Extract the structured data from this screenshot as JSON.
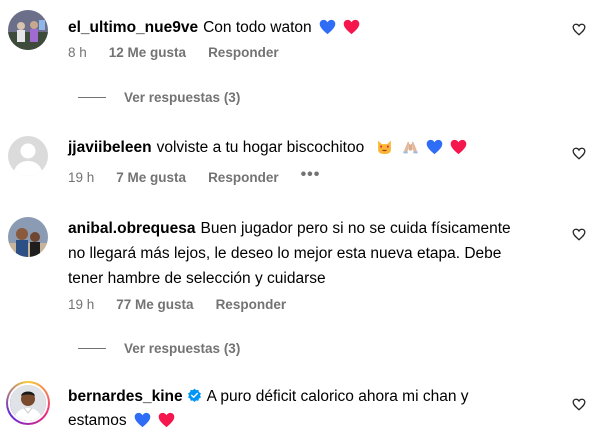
{
  "comments": [
    {
      "username": "el_ultimo_nue9ve",
      "text": "Con todo waton",
      "emojis": [
        "blue-heart",
        "red-heart"
      ],
      "time": "8 h",
      "likes": "12 Me gusta",
      "reply": "Responder",
      "view_replies": "Ver respuestas (3)"
    },
    {
      "username": "jjaviibeleen",
      "text": "volviste a tu hogar biscochitoo",
      "emojis": [
        "smiling-cat-heart-eyes",
        "folded-hands",
        "blue-heart",
        "red-heart"
      ],
      "time": "19 h",
      "likes": "7 Me gusta",
      "reply": "Responder",
      "more": "•••"
    },
    {
      "username": "anibal.obrequesa",
      "text_line1": "Buen jugador pero si no se cuida físicamente",
      "text_line2": "no llegará más lejos, le deseo lo mejor esta nueva etapa. Debe",
      "text_line3": "tener hambre de selección y cuidarse",
      "time": "19 h",
      "likes": "77 Me gusta",
      "reply": "Responder",
      "view_replies": "Ver respuestas (3)"
    },
    {
      "username": "bernardes_kine",
      "verified": true,
      "text_line1": "A puro déficit calorico ahora mi chan y",
      "text_line2": "estamos",
      "emojis": [
        "blue-heart",
        "red-heart"
      ]
    }
  ],
  "colors": {
    "meta": "#737373",
    "blue_heart": "#2f6df6",
    "red_heart": "#f5164d",
    "verified": "#0095f6"
  }
}
